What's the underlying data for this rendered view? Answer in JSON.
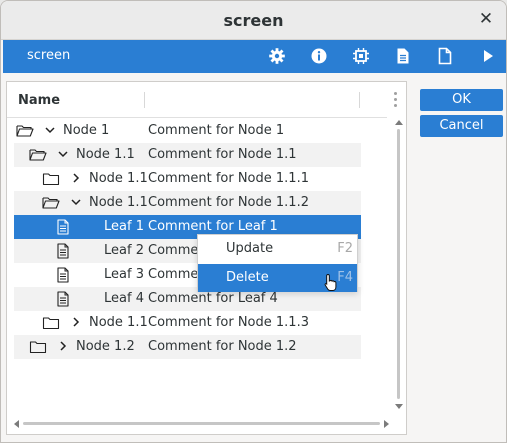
{
  "window": {
    "title": "screen",
    "close_glyph": "✕"
  },
  "toolbar": {
    "label": "screen",
    "buttons": [
      {
        "icon": "gear-icon"
      },
      {
        "icon": "info-icon"
      },
      {
        "icon": "chip-icon"
      },
      {
        "icon": "document-icon"
      },
      {
        "icon": "file-icon"
      },
      {
        "icon": "play-icon"
      }
    ],
    "bg_color": "#2a7ed3"
  },
  "tree": {
    "header": {
      "name": "Name"
    },
    "rows": [
      {
        "name": "Node 1",
        "comment": "Comment for Node 1",
        "type": "folder-open",
        "chevron": "down",
        "level": 0
      },
      {
        "name": "Node 1.1",
        "comment": "Comment for Node 1.1",
        "type": "folder-open",
        "chevron": "down",
        "level": 1
      },
      {
        "name": "Node 1.1",
        "comment": "Comment for Node 1.1.1",
        "type": "folder-closed",
        "chevron": "right",
        "level": 2
      },
      {
        "name": "Node 1.1",
        "comment": "Comment for Node 1.1.2",
        "type": "folder-open",
        "chevron": "down",
        "level": 2
      },
      {
        "name": "Leaf 1",
        "comment": "Comment for Leaf 1",
        "type": "leaf",
        "level": 3,
        "selected": true
      },
      {
        "name": "Leaf 2",
        "comment": "Commen",
        "type": "leaf",
        "level": 3
      },
      {
        "name": "Leaf 3",
        "comment": "Commen",
        "type": "leaf",
        "level": 3
      },
      {
        "name": "Leaf 4",
        "comment": "Comment for Leaf 4",
        "type": "leaf",
        "level": 3
      },
      {
        "name": "Node 1.1",
        "comment": "Comment for Node 1.1.3",
        "type": "folder-closed",
        "chevron": "right",
        "level": 2
      },
      {
        "name": "Node 1.2",
        "comment": "Comment for Node 1.2",
        "type": "folder-closed",
        "chevron": "right",
        "level": 1
      }
    ]
  },
  "buttons": {
    "ok": "OK",
    "cancel": "Cancel"
  },
  "context_menu": {
    "items": [
      {
        "label": "Update",
        "shortcut": "F2"
      },
      {
        "label": "Delete",
        "shortcut": "F4",
        "active": true
      }
    ]
  }
}
